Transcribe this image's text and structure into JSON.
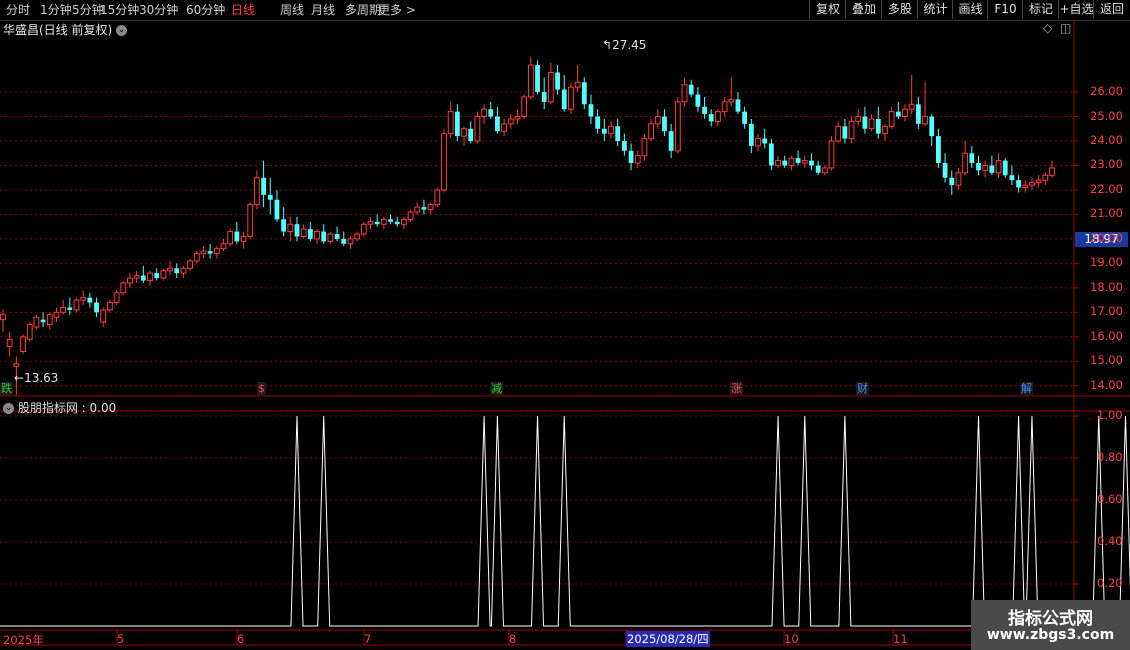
{
  "toolbar": {
    "periods": [
      "分时",
      "1分钟",
      "5分钟",
      "15分钟",
      "30分钟",
      "60分钟",
      "日线",
      "周线",
      "月线",
      "多周期",
      "更多 >"
    ],
    "active_period": "日线",
    "right_buttons": [
      "复权",
      "叠加",
      "多股",
      "统计",
      "画线",
      "F10",
      "标记",
      "+自选",
      "返回"
    ]
  },
  "main_chart": {
    "title": "华盛昌(日线 前复权)",
    "high_label": "27.45",
    "low_label": "13.63",
    "current_price": "18.97",
    "y_ticks": [
      "26.00",
      "25.00",
      "24.00",
      "23.00",
      "22.00",
      "21.00",
      "20.00",
      "19.00",
      "18.00",
      "17.00",
      "16.00",
      "15.00",
      "14.00"
    ],
    "event_tags": [
      {
        "text": "跌",
        "color": "#2ad12a"
      },
      {
        "text": "$",
        "color": "#ff3c3c"
      },
      {
        "text": "减",
        "color": "#2ad12a"
      },
      {
        "text": "涨",
        "color": "#ff3c3c"
      },
      {
        "text": "财",
        "color": "#3c8cff"
      },
      {
        "text": "解",
        "color": "#3c8cff"
      }
    ]
  },
  "indicator": {
    "title": "股朋指标网 : 0.00",
    "y_ticks": [
      "1.00",
      "0.80",
      "0.60",
      "0.40",
      "0.20"
    ]
  },
  "x_axis": {
    "labels": [
      "2025年",
      "5",
      "6",
      "7",
      "8",
      "10",
      "11"
    ],
    "cursor_date": "2025/08/28/四"
  },
  "watermark": {
    "line1": "指标公式网",
    "line2": "www.zbgs3.com"
  },
  "colors": {
    "up": "#ff3c3c",
    "down": "#54ffff",
    "grid": "#7a0000",
    "axis": "#a00000",
    "signal": "#ffffff"
  },
  "chart_data": {
    "type": "candlestick",
    "title": "华盛昌(日线 前复权)",
    "high": 27.45,
    "low": 13.63,
    "last": 18.97,
    "ylim": [
      13.5,
      27.8
    ],
    "indicator": {
      "name": "股朋指标网",
      "value": 0.0,
      "ylim": [
        0,
        1.05
      ],
      "spikes_at_candle_index": [
        44,
        48,
        72,
        74,
        80,
        84,
        116,
        120,
        126,
        146,
        152,
        154,
        164,
        168
      ]
    },
    "candles": [
      [
        16.7,
        17.1,
        16.2,
        16.9
      ],
      [
        15.6,
        16.2,
        15.2,
        15.9
      ],
      [
        14.8,
        15.2,
        13.63,
        14.9
      ],
      [
        15.4,
        16.1,
        15.3,
        16.0
      ],
      [
        15.9,
        16.6,
        15.8,
        16.5
      ],
      [
        16.4,
        16.9,
        16.3,
        16.8
      ],
      [
        16.7,
        17.0,
        16.4,
        16.6
      ],
      [
        16.5,
        17.0,
        16.3,
        16.9
      ],
      [
        16.8,
        17.2,
        16.6,
        17.0
      ],
      [
        17.0,
        17.5,
        16.9,
        17.2
      ],
      [
        17.2,
        17.6,
        16.9,
        17.1
      ],
      [
        17.1,
        17.6,
        17.0,
        17.5
      ],
      [
        17.5,
        17.9,
        17.3,
        17.6
      ],
      [
        17.6,
        17.8,
        17.2,
        17.4
      ],
      [
        17.4,
        17.6,
        16.8,
        17.0
      ],
      [
        16.6,
        17.2,
        16.4,
        17.1
      ],
      [
        17.1,
        17.5,
        17.0,
        17.4
      ],
      [
        17.4,
        17.9,
        17.3,
        17.8
      ],
      [
        17.8,
        18.3,
        17.7,
        18.2
      ],
      [
        18.2,
        18.6,
        18.0,
        18.4
      ],
      [
        18.4,
        18.7,
        18.2,
        18.5
      ],
      [
        18.5,
        18.9,
        18.2,
        18.3
      ],
      [
        18.3,
        18.7,
        18.1,
        18.6
      ],
      [
        18.6,
        18.8,
        18.3,
        18.4
      ],
      [
        18.4,
        18.8,
        18.3,
        18.7
      ],
      [
        18.7,
        19.1,
        18.5,
        18.8
      ],
      [
        18.8,
        19.0,
        18.4,
        18.6
      ],
      [
        18.6,
        18.9,
        18.4,
        18.8
      ],
      [
        18.8,
        19.2,
        18.7,
        19.1
      ],
      [
        19.1,
        19.5,
        19.0,
        19.4
      ],
      [
        19.4,
        19.7,
        19.2,
        19.5
      ],
      [
        19.5,
        19.8,
        19.2,
        19.4
      ],
      [
        19.4,
        19.7,
        19.2,
        19.6
      ],
      [
        19.6,
        20.0,
        19.5,
        19.8
      ],
      [
        19.8,
        20.4,
        19.7,
        20.3
      ],
      [
        20.3,
        20.7,
        19.8,
        19.9
      ],
      [
        19.9,
        20.3,
        19.6,
        20.1
      ],
      [
        20.1,
        21.5,
        20.0,
        21.4
      ],
      [
        21.4,
        22.8,
        21.2,
        22.5
      ],
      [
        22.5,
        23.2,
        21.3,
        21.8
      ],
      [
        21.8,
        22.5,
        21.0,
        21.6
      ],
      [
        21.6,
        22.0,
        20.7,
        20.8
      ],
      [
        20.8,
        21.3,
        20.1,
        20.3
      ],
      [
        20.3,
        20.9,
        19.9,
        20.6
      ],
      [
        20.6,
        20.9,
        19.9,
        20.1
      ],
      [
        20.1,
        20.6,
        20.0,
        20.4
      ],
      [
        20.4,
        20.7,
        19.9,
        20.0
      ],
      [
        20.0,
        20.4,
        19.8,
        20.3
      ],
      [
        20.3,
        20.6,
        19.8,
        19.9
      ],
      [
        19.9,
        20.3,
        19.8,
        20.2
      ],
      [
        20.2,
        20.5,
        19.9,
        20.0
      ],
      [
        20.0,
        20.3,
        19.7,
        19.8
      ],
      [
        19.8,
        20.1,
        19.6,
        20.0
      ],
      [
        20.0,
        20.3,
        19.9,
        20.2
      ],
      [
        20.2,
        20.7,
        20.1,
        20.6
      ],
      [
        20.6,
        20.9,
        20.4,
        20.7
      ],
      [
        20.7,
        21.0,
        20.5,
        20.6
      ],
      [
        20.6,
        20.9,
        20.4,
        20.8
      ],
      [
        20.8,
        21.0,
        20.6,
        20.7
      ],
      [
        20.7,
        20.9,
        20.5,
        20.6
      ],
      [
        20.6,
        20.9,
        20.4,
        20.8
      ],
      [
        20.8,
        21.2,
        20.7,
        21.1
      ],
      [
        21.1,
        21.5,
        21.0,
        21.3
      ],
      [
        21.3,
        21.6,
        21.0,
        21.2
      ],
      [
        21.2,
        21.5,
        21.0,
        21.4
      ],
      [
        21.4,
        22.1,
        21.3,
        22.0
      ],
      [
        22.0,
        24.5,
        21.9,
        24.3
      ],
      [
        24.3,
        25.6,
        24.1,
        25.2
      ],
      [
        25.2,
        25.5,
        24.0,
        24.2
      ],
      [
        24.2,
        24.6,
        23.8,
        24.5
      ],
      [
        24.5,
        24.8,
        23.9,
        24.0
      ],
      [
        24.0,
        25.2,
        23.9,
        25.0
      ],
      [
        25.0,
        25.5,
        24.7,
        25.3
      ],
      [
        25.3,
        25.6,
        24.9,
        25.0
      ],
      [
        25.0,
        25.4,
        24.3,
        24.4
      ],
      [
        24.4,
        24.9,
        24.2,
        24.7
      ],
      [
        24.7,
        25.1,
        24.5,
        24.9
      ],
      [
        24.9,
        25.3,
        24.7,
        25.0
      ],
      [
        25.0,
        25.9,
        24.9,
        25.8
      ],
      [
        25.8,
        27.45,
        25.7,
        27.1
      ],
      [
        27.1,
        27.3,
        25.9,
        26.0
      ],
      [
        26.0,
        26.6,
        25.3,
        25.6
      ],
      [
        25.6,
        27.2,
        25.5,
        26.8
      ],
      [
        26.8,
        27.1,
        25.9,
        26.1
      ],
      [
        26.1,
        26.7,
        25.2,
        25.3
      ],
      [
        25.3,
        26.4,
        25.1,
        26.2
      ],
      [
        26.2,
        27.1,
        26.0,
        26.4
      ],
      [
        26.4,
        26.6,
        25.3,
        25.5
      ],
      [
        25.5,
        25.9,
        24.7,
        25.0
      ],
      [
        25.0,
        25.3,
        24.3,
        24.5
      ],
      [
        24.5,
        24.9,
        24.0,
        24.3
      ],
      [
        24.3,
        24.8,
        24.1,
        24.6
      ],
      [
        24.6,
        24.9,
        23.8,
        24.0
      ],
      [
        24.0,
        24.3,
        23.4,
        23.6
      ],
      [
        23.6,
        23.9,
        22.8,
        23.1
      ],
      [
        23.1,
        23.6,
        22.9,
        23.4
      ],
      [
        23.4,
        24.3,
        23.2,
        24.1
      ],
      [
        24.1,
        24.9,
        24.0,
        24.7
      ],
      [
        24.7,
        25.3,
        24.5,
        25.0
      ],
      [
        25.0,
        25.3,
        24.2,
        24.4
      ],
      [
        24.4,
        24.7,
        23.3,
        23.6
      ],
      [
        23.6,
        25.8,
        23.5,
        25.6
      ],
      [
        25.6,
        26.6,
        25.4,
        26.3
      ],
      [
        26.3,
        26.5,
        25.8,
        25.9
      ],
      [
        25.9,
        26.2,
        25.2,
        25.4
      ],
      [
        25.4,
        25.8,
        24.9,
        25.1
      ],
      [
        25.1,
        25.3,
        24.6,
        24.8
      ],
      [
        24.8,
        25.3,
        24.6,
        25.2
      ],
      [
        25.2,
        25.8,
        25.0,
        25.6
      ],
      [
        25.6,
        26.6,
        25.4,
        25.7
      ],
      [
        25.7,
        26.0,
        25.1,
        25.2
      ],
      [
        25.2,
        25.4,
        24.5,
        24.7
      ],
      [
        24.7,
        24.9,
        23.5,
        23.8
      ],
      [
        23.8,
        24.3,
        23.6,
        24.1
      ],
      [
        24.1,
        24.5,
        23.7,
        23.9
      ],
      [
        23.9,
        24.1,
        22.8,
        23.0
      ],
      [
        23.0,
        23.4,
        22.9,
        23.2
      ],
      [
        23.2,
        23.4,
        22.9,
        23.0
      ],
      [
        23.0,
        23.4,
        22.8,
        23.3
      ],
      [
        23.3,
        23.6,
        23.0,
        23.1
      ],
      [
        23.1,
        23.4,
        22.9,
        23.2
      ],
      [
        23.2,
        23.5,
        22.8,
        23.0
      ],
      [
        23.0,
        23.2,
        22.6,
        22.7
      ],
      [
        22.7,
        23.0,
        22.6,
        22.9
      ],
      [
        22.9,
        24.2,
        22.8,
        24.0
      ],
      [
        24.0,
        24.8,
        23.9,
        24.6
      ],
      [
        24.6,
        24.9,
        23.9,
        24.1
      ],
      [
        24.1,
        25.0,
        23.9,
        24.8
      ],
      [
        24.8,
        25.3,
        24.6,
        25.0
      ],
      [
        25.0,
        25.4,
        24.3,
        24.5
      ],
      [
        24.5,
        25.1,
        24.4,
        24.9
      ],
      [
        24.9,
        25.4,
        24.1,
        24.3
      ],
      [
        24.3,
        24.7,
        24.0,
        24.6
      ],
      [
        24.6,
        25.4,
        24.5,
        25.2
      ],
      [
        25.2,
        25.6,
        24.9,
        25.0
      ],
      [
        25.0,
        25.5,
        24.8,
        25.3
      ],
      [
        25.3,
        26.7,
        25.1,
        25.5
      ],
      [
        25.5,
        25.8,
        24.5,
        24.7
      ],
      [
        24.7,
        26.4,
        24.6,
        25.0
      ],
      [
        25.0,
        25.1,
        23.8,
        24.2
      ],
      [
        24.2,
        24.5,
        22.9,
        23.1
      ],
      [
        23.1,
        23.5,
        22.3,
        22.5
      ],
      [
        22.5,
        22.8,
        21.8,
        22.2
      ],
      [
        22.2,
        22.9,
        22.0,
        22.7
      ],
      [
        22.7,
        24.0,
        22.6,
        23.5
      ],
      [
        23.5,
        23.8,
        22.9,
        23.1
      ],
      [
        23.1,
        23.4,
        22.6,
        22.8
      ],
      [
        22.8,
        23.2,
        22.5,
        23.0
      ],
      [
        23.0,
        23.4,
        22.6,
        22.7
      ],
      [
        22.7,
        23.5,
        22.5,
        23.2
      ],
      [
        23.2,
        23.3,
        22.5,
        22.6
      ],
      [
        22.6,
        23.0,
        22.2,
        22.4
      ],
      [
        22.4,
        22.6,
        21.9,
        22.1
      ],
      [
        22.1,
        22.4,
        21.9,
        22.2
      ],
      [
        22.2,
        22.5,
        22.0,
        22.3
      ],
      [
        22.3,
        22.6,
        22.1,
        22.4
      ],
      [
        22.4,
        22.7,
        22.2,
        22.6
      ],
      [
        22.6,
        23.2,
        22.5,
        22.9
      ]
    ]
  }
}
